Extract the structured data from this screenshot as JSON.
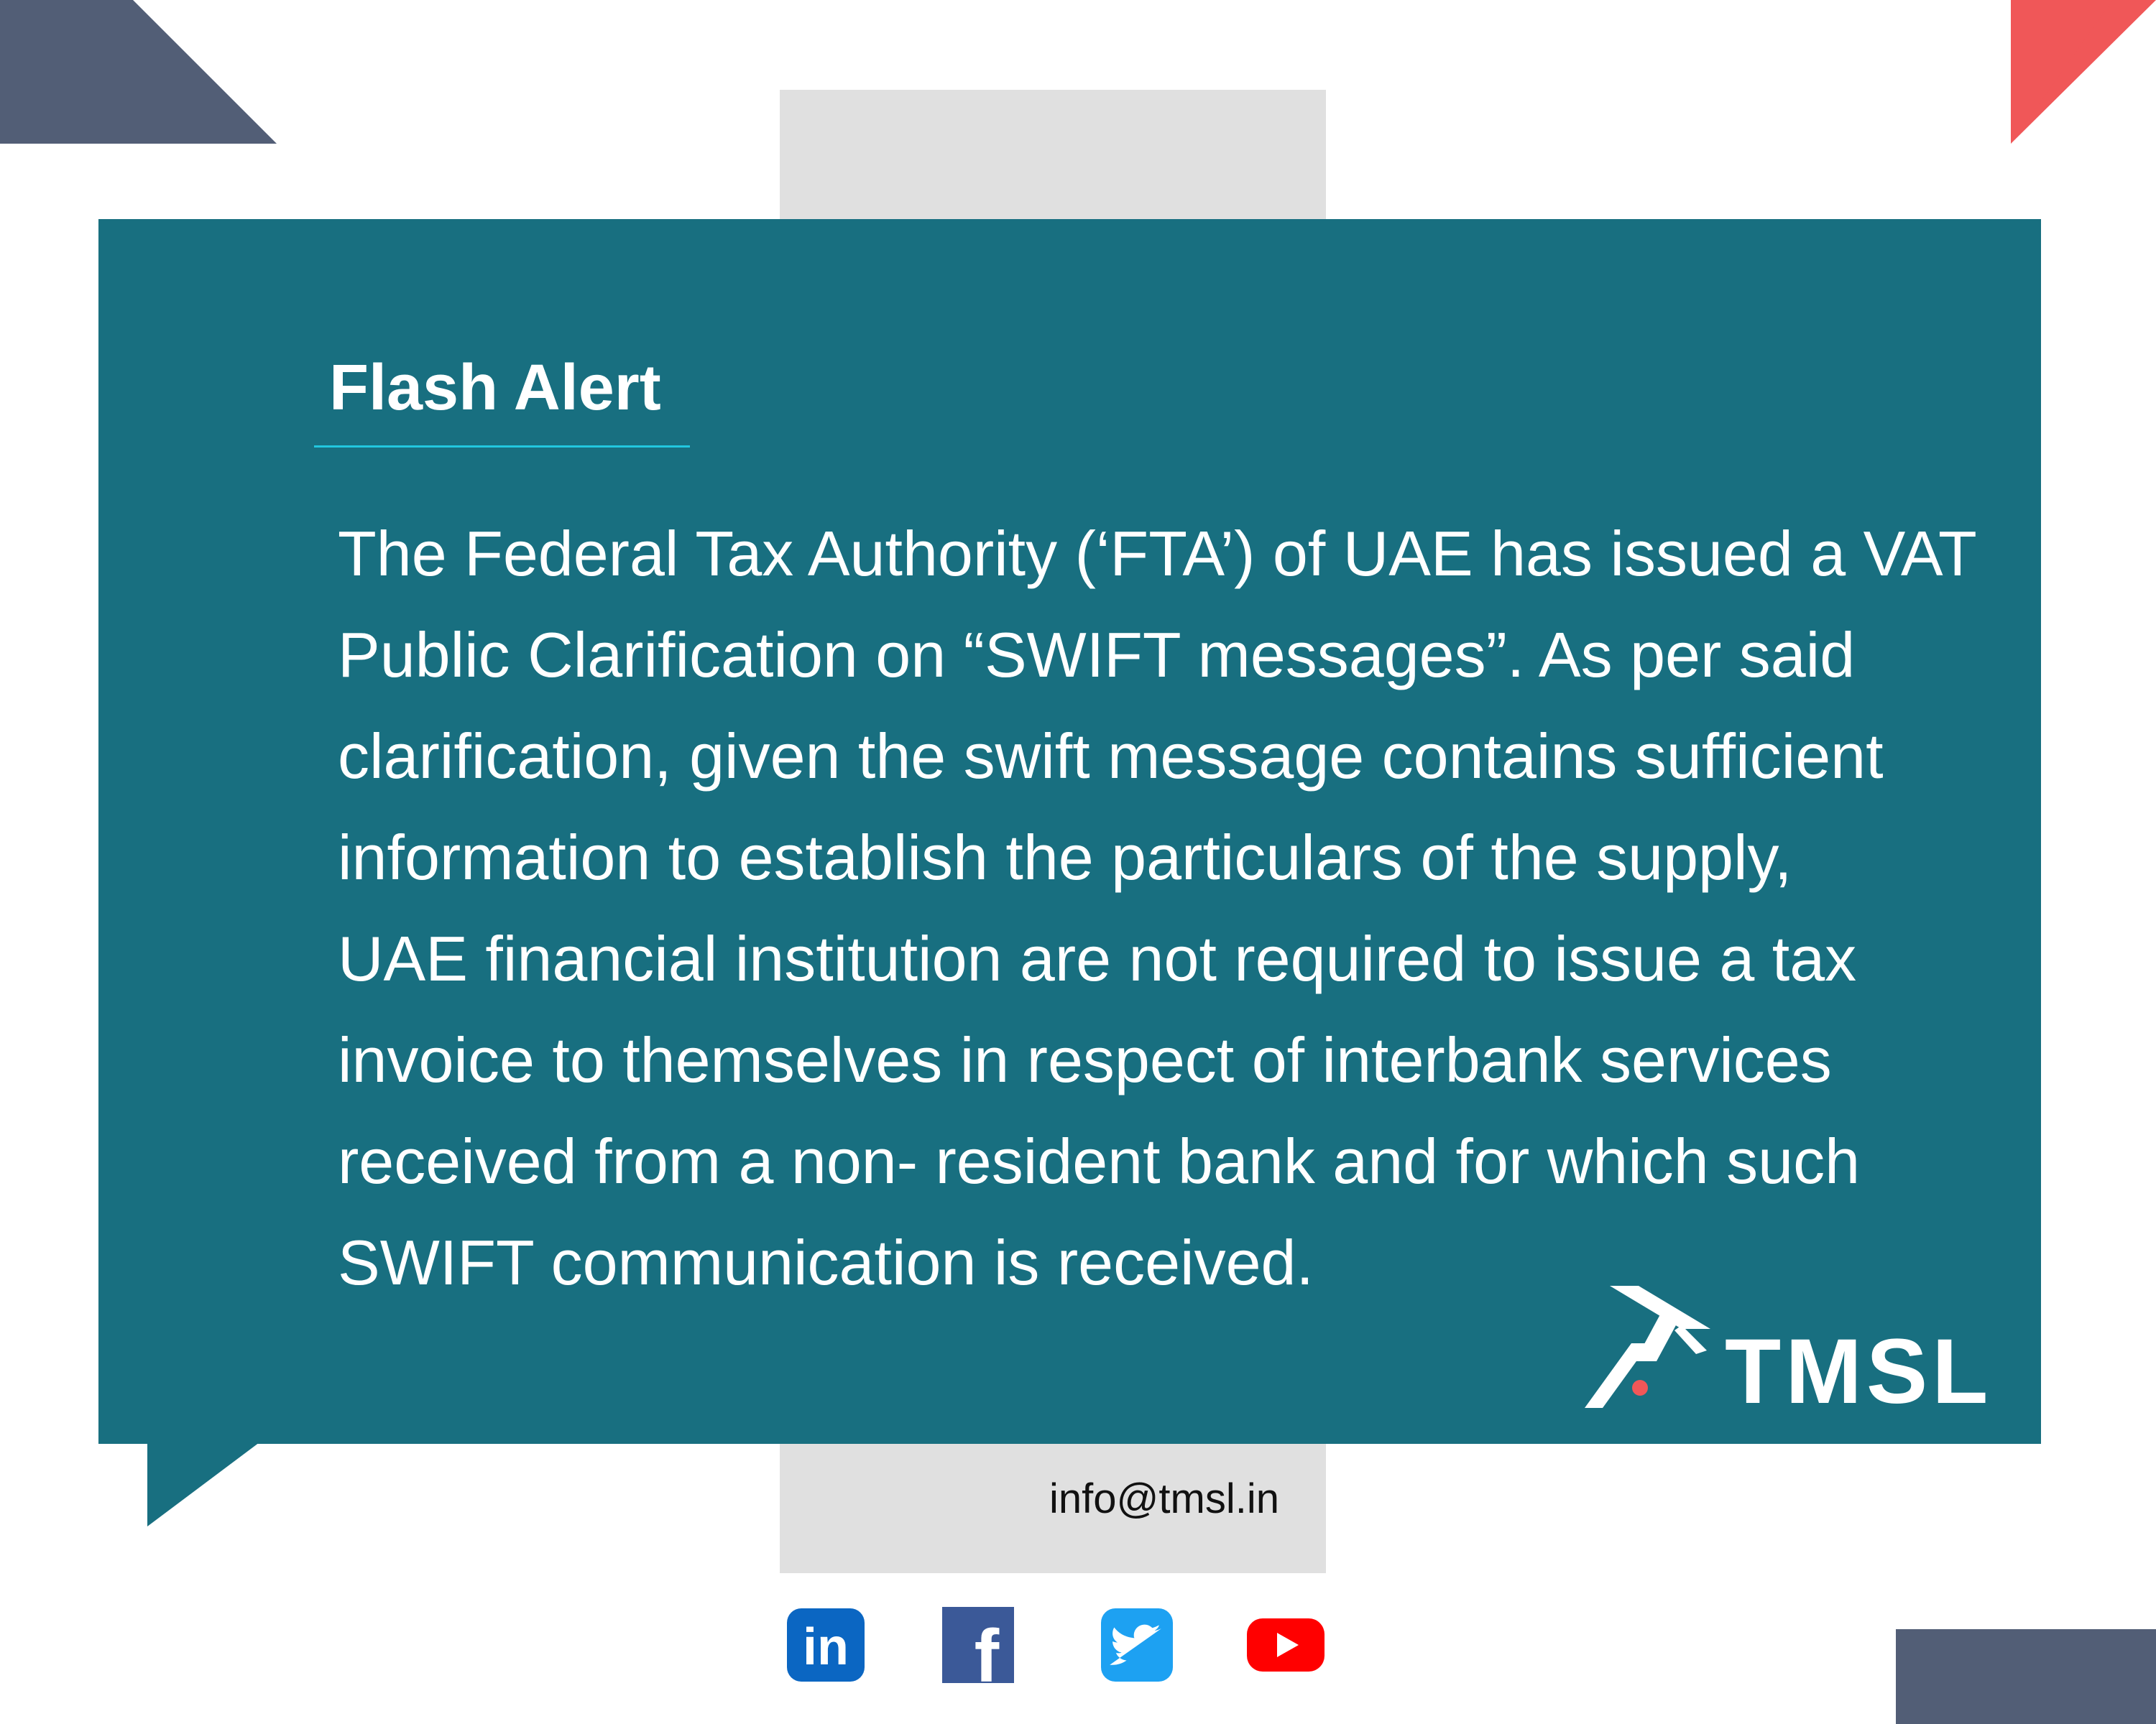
{
  "card": {
    "title": "Flash Alert",
    "body_lines": [
      "The Federal Tax Authority (‘FTA’) of UAE has issued a VAT",
      "Public Clarification on “SWIFT messages”. As per said",
      "clarification, given the swift message contains sufficient",
      "information to establish the particulars of the supply,",
      "UAE financial institution are not required to issue a tax",
      "invoice to themselves in respect of interbank services",
      "received from a non- resident bank and for which such",
      "SWIFT communication is received."
    ]
  },
  "brand": {
    "logo_text": "TMSL"
  },
  "contact": {
    "email": "info@tmsl.in"
  },
  "social": [
    {
      "icon": "linkedin-icon",
      "label": "in",
      "color": "#0b66c2"
    },
    {
      "icon": "facebook-icon",
      "label": "f",
      "color": "#3b5998"
    },
    {
      "icon": "twitter-icon",
      "label": "",
      "color": "#1da1f2"
    },
    {
      "icon": "youtube-icon",
      "label": "",
      "color": "#ff0000"
    }
  ],
  "colors": {
    "teal": "#186f80",
    "slate": "#525e76",
    "coral": "#f05758",
    "panel_gray": "#e0e0e0",
    "underline": "#22c7e0"
  }
}
